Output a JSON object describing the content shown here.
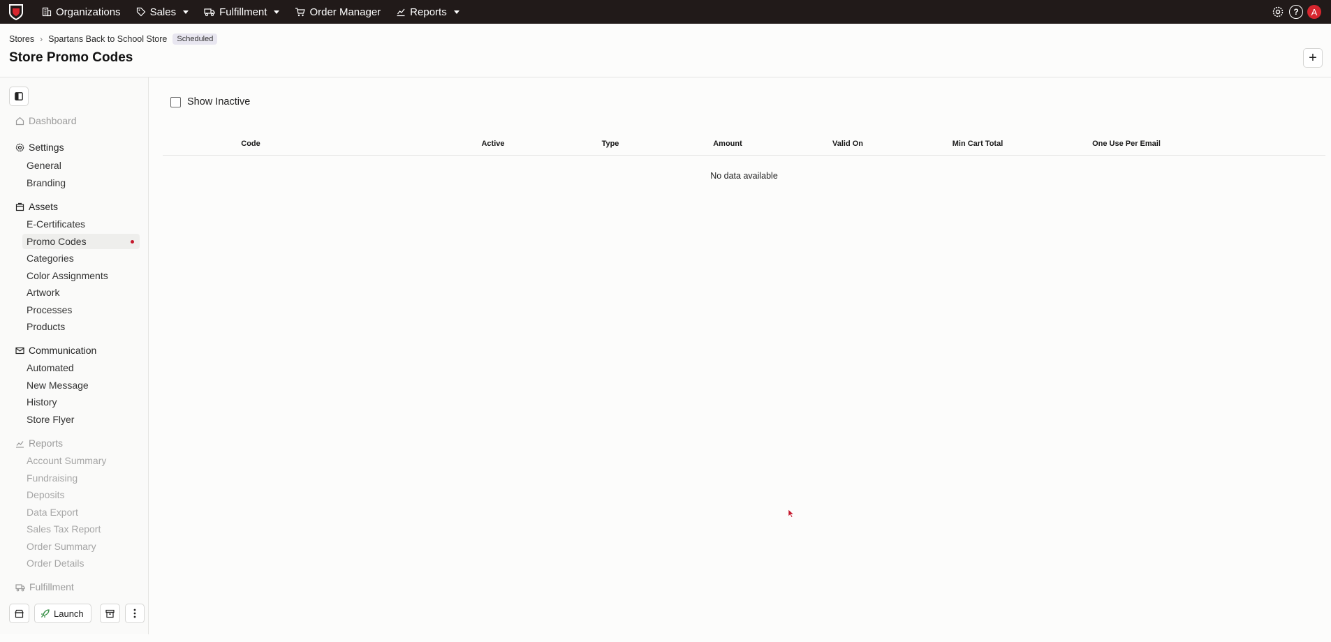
{
  "topbar": {
    "nav": [
      {
        "label": "Organizations",
        "icon": "building-icon",
        "dropdown": false
      },
      {
        "label": "Sales",
        "icon": "tag-icon",
        "dropdown": true
      },
      {
        "label": "Fulfillment",
        "icon": "truck-icon",
        "dropdown": true
      },
      {
        "label": "Order Manager",
        "icon": "cart-icon",
        "dropdown": false
      },
      {
        "label": "Reports",
        "icon": "chart-icon",
        "dropdown": true
      }
    ],
    "help_label": "?",
    "avatar_initial": "A"
  },
  "breadcrumb": {
    "root": "Stores",
    "store": "Spartans Back to School Store",
    "status_badge": "Scheduled"
  },
  "page_title": "Store Promo Codes",
  "add_label": "+",
  "sidebar": {
    "dashboard": "Dashboard",
    "settings": {
      "label": "Settings",
      "items": [
        "General",
        "Branding"
      ]
    },
    "assets": {
      "label": "Assets",
      "items": [
        "E-Certificates",
        "Promo Codes",
        "Categories",
        "Color Assignments",
        "Artwork",
        "Processes",
        "Products"
      ]
    },
    "communication": {
      "label": "Communication",
      "items": [
        "Automated",
        "New Message",
        "History",
        "Store Flyer"
      ]
    },
    "reports": {
      "label": "Reports",
      "items": [
        "Account Summary",
        "Fundraising",
        "Deposits",
        "Data Export",
        "Sales Tax Report",
        "Order Summary",
        "Order Details"
      ]
    },
    "fulfillment": "Fulfillment",
    "footer": {
      "launch_label": "Launch"
    }
  },
  "filter": {
    "show_inactive_label": "Show Inactive",
    "show_inactive_checked": false
  },
  "table": {
    "columns": [
      "Code",
      "Active",
      "Type",
      "Amount",
      "Valid On",
      "Min Cart Total",
      "One Use Per Email"
    ],
    "empty_text": "No data available"
  },
  "colors": {
    "topbar": "#211a19",
    "accent": "#d7262e",
    "active_dot": "#c5192d"
  }
}
